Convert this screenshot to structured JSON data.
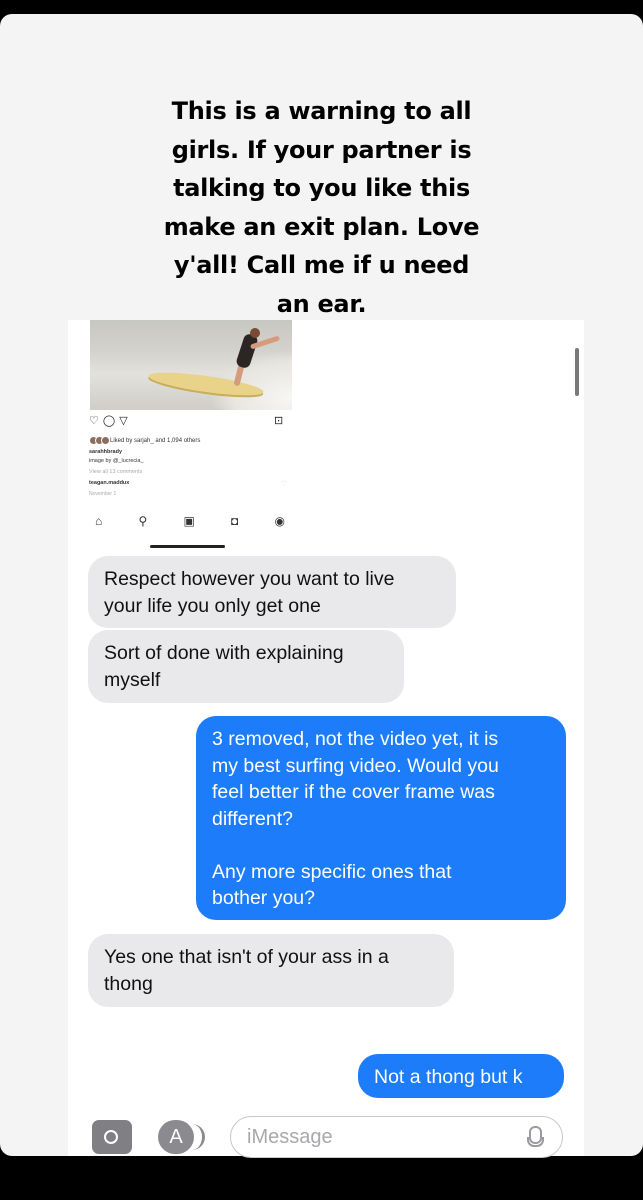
{
  "story": {
    "caption": "This is a warning to all\ngirls. If your partner is\ntalking to you like this\nmake an exit plan. Love\ny'all! Call me if u need\nan ear."
  },
  "instagram_post": {
    "likes": "Liked by sarjah_ and 1,094 others",
    "username": "sarahhbrady",
    "photo_credit": "image by @_lucrecia_",
    "view_comments": "View all 13 comments",
    "comment_user": "teagan.maddux",
    "date": "November 1"
  },
  "messages": [
    {
      "from": "them",
      "text": "Respect however you want to live\nyour life you only get one"
    },
    {
      "from": "them",
      "text": "Sort of done with explaining\nmyself"
    },
    {
      "from": "me",
      "text": "3 removed, not the video yet, it is\nmy best surfing video. Would you\nfeel better if the cover frame was\ndifferent?\n\nAny more specific ones that\nbother you?"
    },
    {
      "from": "them",
      "text": "Yes one that isn't of your ass in a\nthong"
    },
    {
      "from": "me",
      "text": "Not a thong but k"
    }
  ],
  "compose": {
    "placeholder": "iMessage"
  },
  "colors": {
    "outgoing_bubble": "#1c7cf9",
    "incoming_bubble": "#e9e9eb"
  }
}
